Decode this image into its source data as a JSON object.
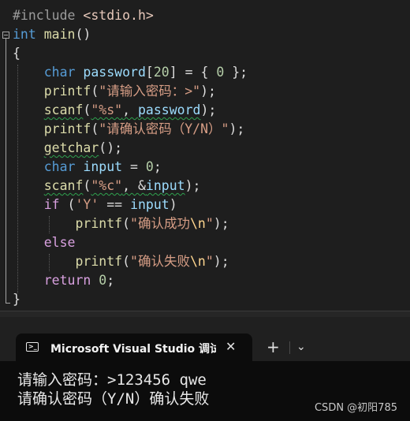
{
  "editor": {
    "lines": [
      [
        {
          "t": "#include ",
          "c": "pre"
        },
        {
          "t": "<stdio.h>",
          "c": "inc"
        }
      ],
      [
        {
          "t": "int",
          "c": "kw"
        },
        {
          "t": " main",
          "c": "fn"
        },
        {
          "t": "()",
          "c": "p"
        }
      ],
      [
        {
          "t": "{",
          "c": "p"
        }
      ],
      [
        {
          "t": "    "
        },
        {
          "t": "char",
          "c": "kw"
        },
        {
          "t": " password",
          "c": "id"
        },
        {
          "t": "[",
          "c": "p"
        },
        {
          "t": "20",
          "c": "num"
        },
        {
          "t": "] = { ",
          "c": "p"
        },
        {
          "t": "0",
          "c": "num"
        },
        {
          "t": " };",
          "c": "p"
        }
      ],
      [
        {
          "t": "    "
        },
        {
          "t": "printf",
          "c": "fn"
        },
        {
          "t": "(",
          "c": "p"
        },
        {
          "t": "\"请输入密码：>\"",
          "c": "str"
        },
        {
          "t": ");",
          "c": "p"
        }
      ],
      [
        {
          "t": "    "
        },
        {
          "t": "scanf",
          "c": "fn sq"
        },
        {
          "t": "(",
          "c": "p"
        },
        {
          "t": "\"%s\"",
          "c": "str sq"
        },
        {
          "t": ", ",
          "c": "p sq"
        },
        {
          "t": "password",
          "c": "id sq"
        },
        {
          "t": ");",
          "c": "p"
        }
      ],
      [
        {
          "t": "    "
        },
        {
          "t": "printf",
          "c": "fn"
        },
        {
          "t": "(",
          "c": "p"
        },
        {
          "t": "\"请确认密码（Y/N）\"",
          "c": "str"
        },
        {
          "t": ");",
          "c": "p"
        }
      ],
      [
        {
          "t": "    "
        },
        {
          "t": "getchar",
          "c": "fn sq"
        },
        {
          "t": "();",
          "c": "p"
        }
      ],
      [
        {
          "t": "    "
        },
        {
          "t": "char",
          "c": "kw"
        },
        {
          "t": " input",
          "c": "id"
        },
        {
          "t": " = ",
          "c": "p"
        },
        {
          "t": "0",
          "c": "num"
        },
        {
          "t": ";",
          "c": "p"
        }
      ],
      [
        {
          "t": "    "
        },
        {
          "t": "scanf",
          "c": "fn sq"
        },
        {
          "t": "(",
          "c": "p"
        },
        {
          "t": "\"%c\"",
          "c": "str sq"
        },
        {
          "t": ", &",
          "c": "p sq"
        },
        {
          "t": "input",
          "c": "id sq"
        },
        {
          "t": ");",
          "c": "p"
        }
      ],
      [
        {
          "t": "    "
        },
        {
          "t": "if",
          "c": "ctl"
        },
        {
          "t": " (",
          "c": "p"
        },
        {
          "t": "'Y'",
          "c": "str"
        },
        {
          "t": " == ",
          "c": "p"
        },
        {
          "t": "input",
          "c": "id"
        },
        {
          "t": ")",
          "c": "p"
        }
      ],
      [
        {
          "t": "        "
        },
        {
          "t": "printf",
          "c": "fn"
        },
        {
          "t": "(",
          "c": "p"
        },
        {
          "t": "\"确认成功",
          "c": "str"
        },
        {
          "t": "\\n",
          "c": "esc"
        },
        {
          "t": "\"",
          "c": "str"
        },
        {
          "t": ");",
          "c": "p"
        }
      ],
      [
        {
          "t": "    "
        },
        {
          "t": "else",
          "c": "ctl"
        }
      ],
      [
        {
          "t": "        "
        },
        {
          "t": "printf",
          "c": "fn"
        },
        {
          "t": "(",
          "c": "p"
        },
        {
          "t": "\"确认失败",
          "c": "str"
        },
        {
          "t": "\\n",
          "c": "esc"
        },
        {
          "t": "\"",
          "c": "str"
        },
        {
          "t": ");",
          "c": "p"
        }
      ],
      [
        {
          "t": "    "
        },
        {
          "t": "return",
          "c": "ctl"
        },
        {
          "t": " 0",
          "c": "num"
        },
        {
          "t": ";",
          "c": "p"
        }
      ],
      [
        {
          "t": "}",
          "c": "p"
        }
      ]
    ]
  },
  "terminal": {
    "tab_title": "Microsoft Visual Studio 调试控",
    "close_glyph": "✕",
    "new_tab_glyph": "+",
    "dropdown_glyph": "⌄",
    "output": [
      "请输入密码：>123456 qwe",
      "请确认密码（Y/N）确认失败"
    ],
    "watermark": "CSDN @初阳785"
  }
}
